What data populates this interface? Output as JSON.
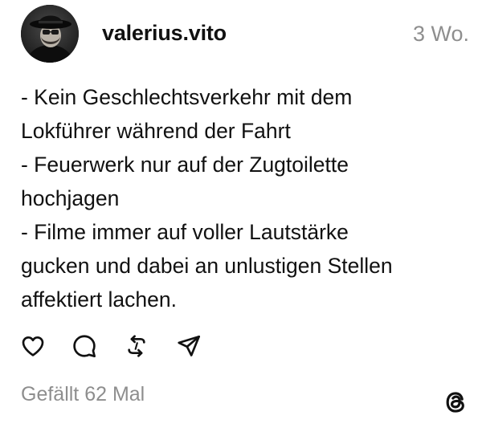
{
  "post": {
    "username": "valerius.vito",
    "timestamp": "3 Wo.",
    "body_lines": [
      "- Kein Geschlechtsverkehr mit dem",
      "Lokführer während der Fahrt",
      "- Feuerwerk nur auf der Zugtoilette",
      "hochjagen",
      "- Filme immer auf voller Lautstärke",
      "gucken und dabei an unlustigen Stellen",
      "affektiert lachen."
    ],
    "likes_text": "Gefällt 62 Mal"
  },
  "icons": {
    "like": "heart-icon",
    "comment": "speech-bubble-icon",
    "repost": "repost-icon",
    "share": "send-icon",
    "brand": "threads-logo-icon"
  },
  "colors": {
    "text": "#111111",
    "muted": "#8e8e8e",
    "background": "#ffffff"
  }
}
